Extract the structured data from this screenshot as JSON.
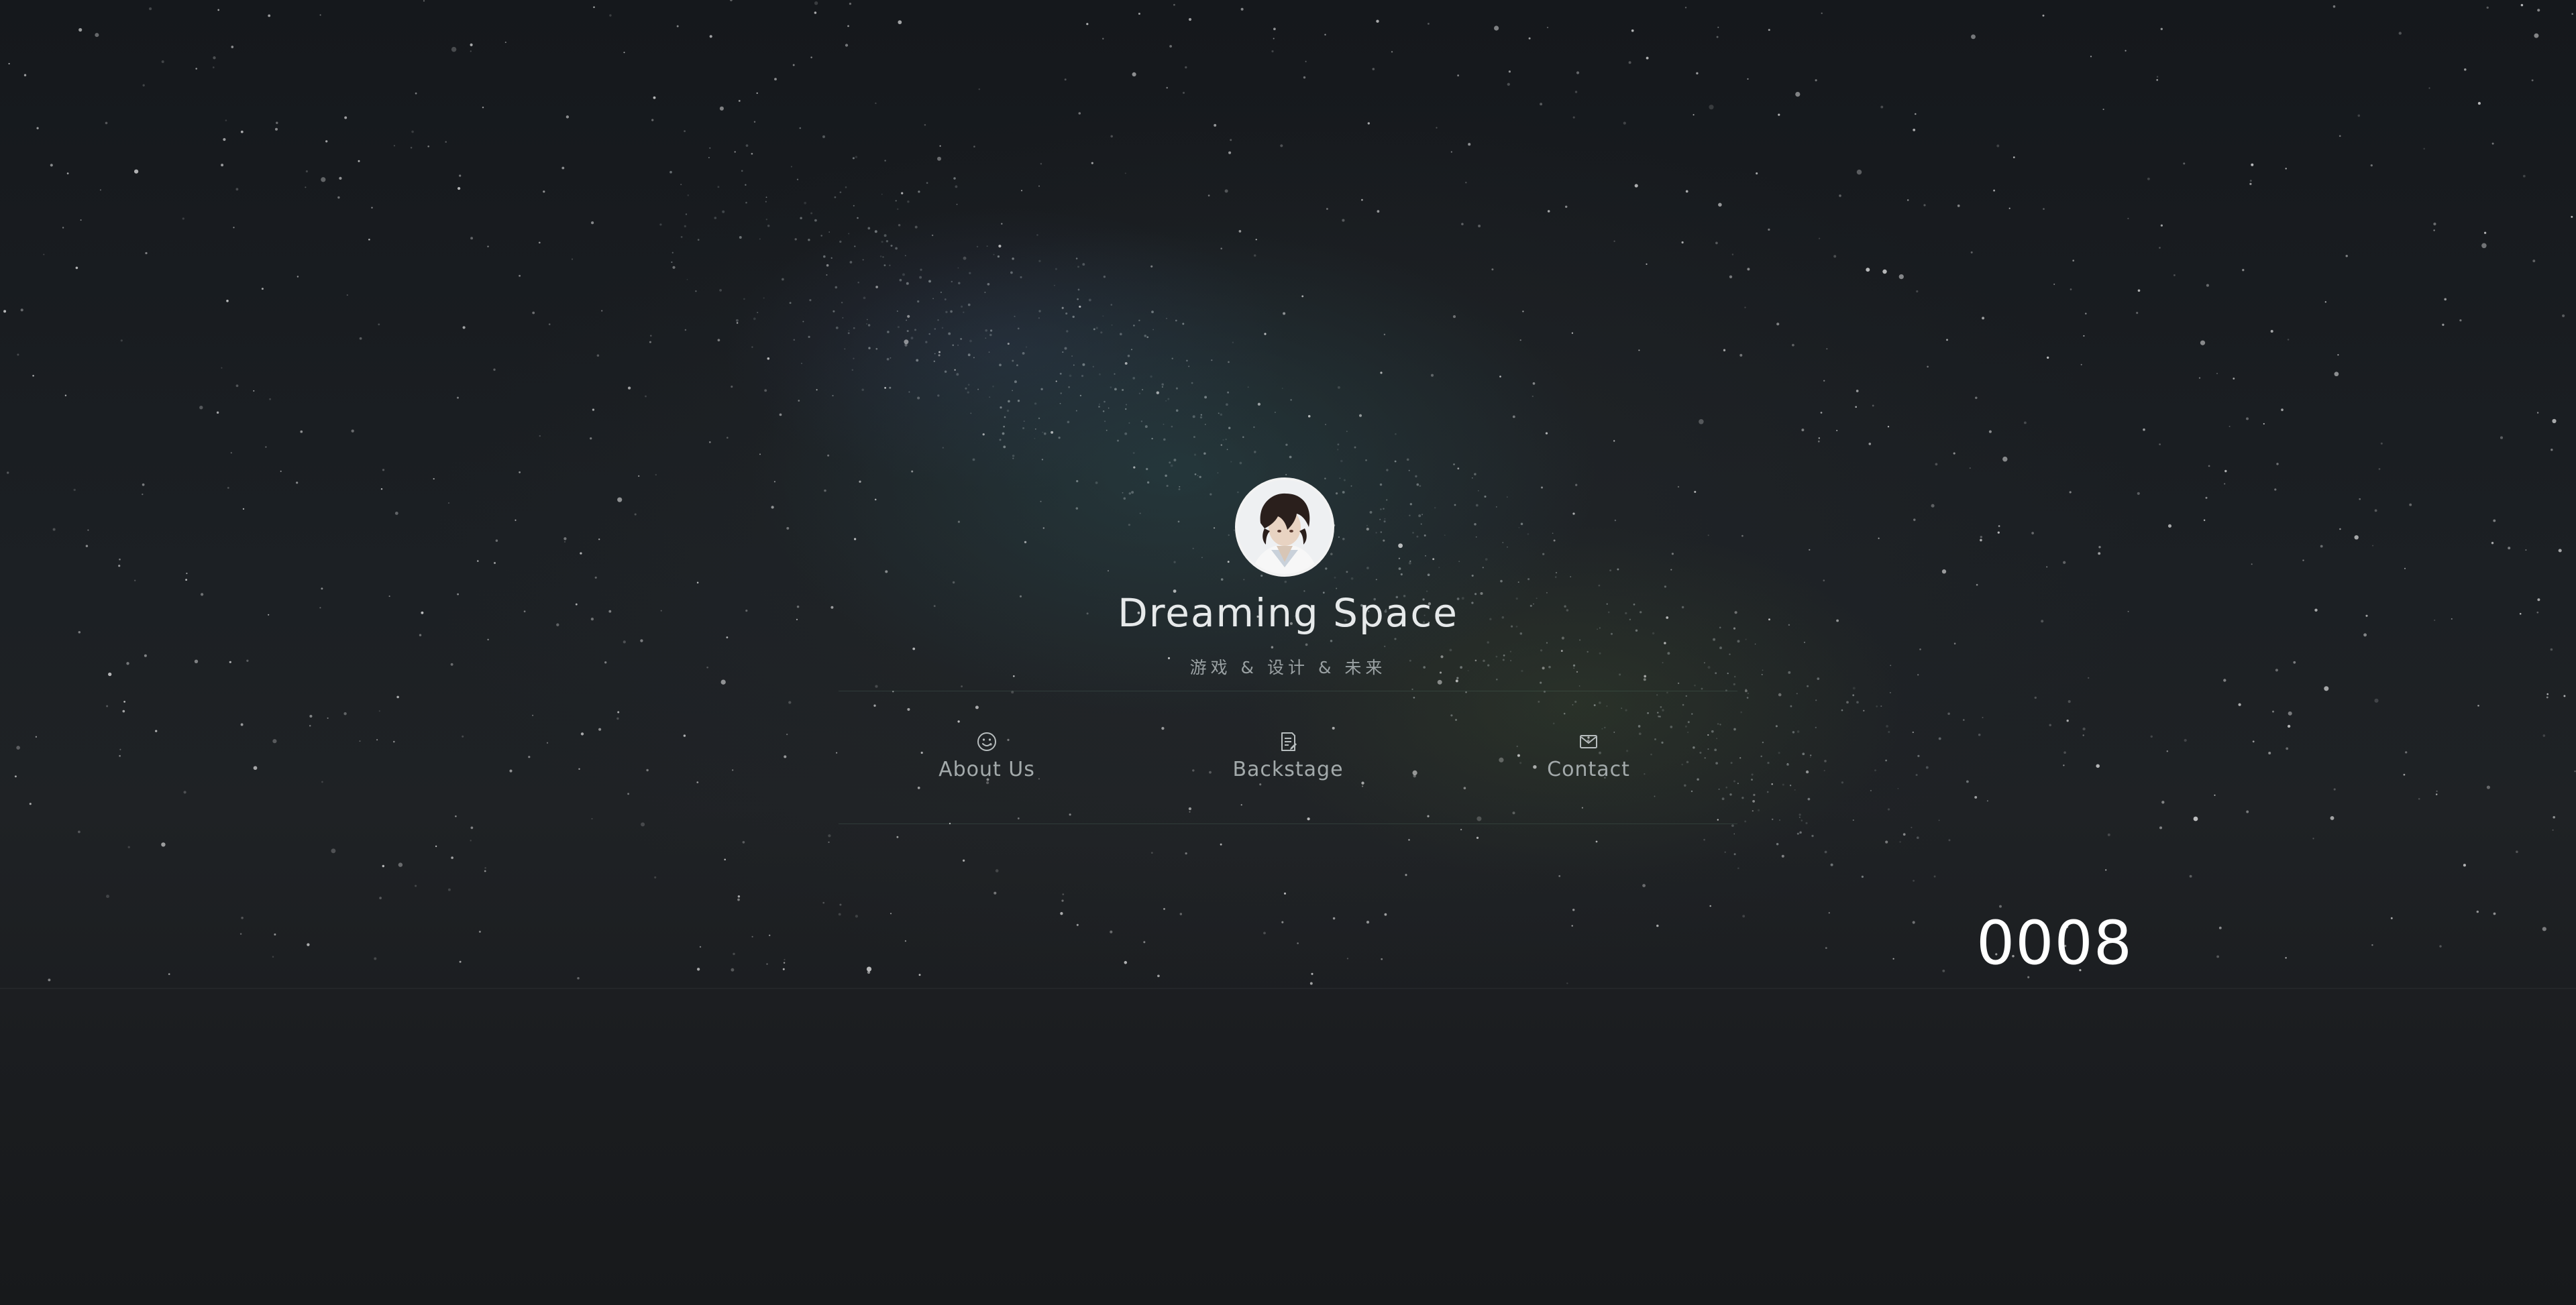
{
  "site": {
    "title": "Dreaming Space",
    "tagline": "游戏 & 设计 & 未来",
    "avatar_icon": "avatar-portrait"
  },
  "nav": [
    {
      "label": "About Us",
      "icon": "smile-icon"
    },
    {
      "label": "Backstage",
      "icon": "notes-icon"
    },
    {
      "label": "Contact",
      "icon": "mail-icon"
    }
  ],
  "counter": {
    "value": "0008"
  },
  "colors": {
    "background": "#17191c",
    "text": "#e6e9ea",
    "muted": "#a3aaab",
    "counter": "#ffffff"
  }
}
